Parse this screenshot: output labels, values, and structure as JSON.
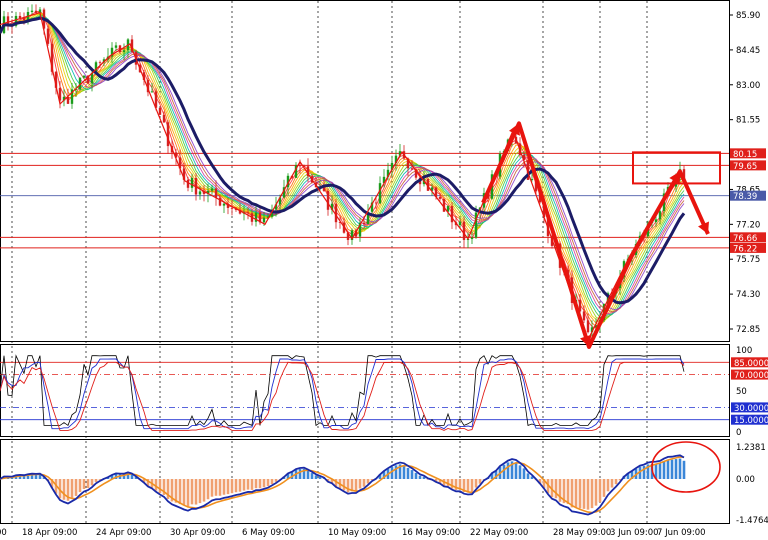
{
  "chart_data": {
    "type": "line",
    "symbol_window": {
      "price_scale": [
        "85.90",
        "84.45",
        "83.00",
        "81.55",
        "78.65",
        "77.20",
        "75.75",
        "74.30",
        "72.85"
      ],
      "price_values": [
        85.9,
        84.45,
        83.0,
        81.55,
        78.65,
        77.2,
        75.75,
        74.3,
        72.85
      ],
      "current_price": {
        "label": "78.39",
        "value": 78.39
      },
      "resistance_lines": [
        {
          "label": "80.15",
          "value": 80.15
        },
        {
          "label": "79.65",
          "value": 79.65
        }
      ],
      "support_lines": [
        {
          "label": "76.66",
          "value": 76.66
        },
        {
          "label": "76.22",
          "value": 76.22
        }
      ],
      "ylim": [
        72.0,
        86.6
      ]
    },
    "oscillator": {
      "scale": [
        "100",
        "85.0000",
        "70.0000",
        "50",
        "30.0000",
        "15.0000",
        "0"
      ],
      "levels": [
        85,
        70,
        30,
        15
      ],
      "ylim": [
        0,
        100
      ]
    },
    "macd": {
      "scale": [
        "1.2381",
        "0.00",
        "-1.4764"
      ],
      "max": 1.2381,
      "min": -1.4764
    },
    "time_axis": [
      "18 Apr 09:00",
      "24 Apr 09:00",
      "30 Apr 09:00",
      "6 May 09:00",
      "10 May 09:00",
      "16 May 09:00",
      "22 May 09:00",
      "28 May 09:00",
      "3 Jun 09:00",
      "7 Jun 09:00"
    ],
    "trend_path": [
      {
        "x": 0,
        "y": 85.5
      },
      {
        "x": 40,
        "y": 86.0
      },
      {
        "x": 60,
        "y": 82.2
      },
      {
        "x": 110,
        "y": 84.2
      },
      {
        "x": 130,
        "y": 84.7
      },
      {
        "x": 185,
        "y": 79.0
      },
      {
        "x": 265,
        "y": 77.2
      },
      {
        "x": 300,
        "y": 79.8
      },
      {
        "x": 352,
        "y": 76.6
      },
      {
        "x": 402,
        "y": 80.2
      },
      {
        "x": 468,
        "y": 76.6
      },
      {
        "x": 513,
        "y": 81.1
      },
      {
        "x": 588,
        "y": 72.4
      },
      {
        "x": 630,
        "y": 75.9
      },
      {
        "x": 680,
        "y": 79.2
      }
    ],
    "arrow_path": [
      {
        "x": 483,
        "y": 78.1
      },
      {
        "x": 519,
        "y": 81.4
      },
      {
        "x": 589,
        "y": 72.1
      },
      {
        "x": 633,
        "y": 76.0
      },
      {
        "x": 680,
        "y": 79.4
      },
      {
        "x": 708,
        "y": 76.8
      }
    ]
  }
}
